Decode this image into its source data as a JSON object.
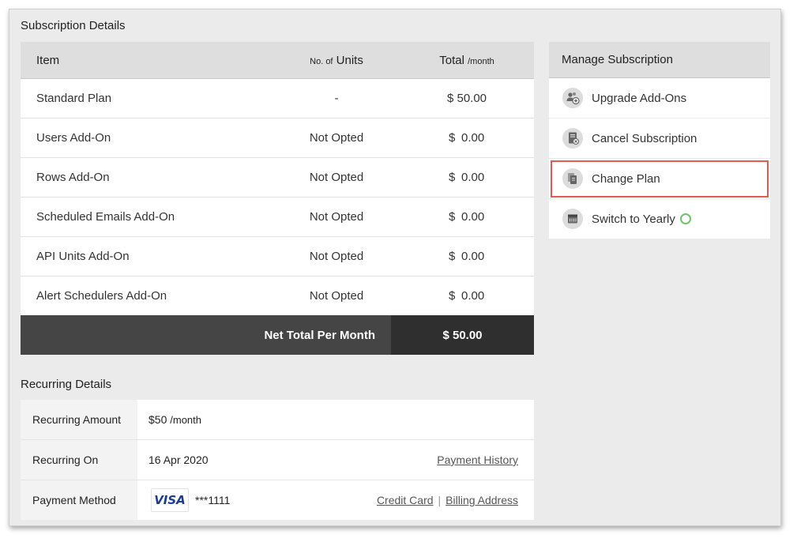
{
  "subscription": {
    "title": "Subscription Details",
    "headers": {
      "item": "Item",
      "units_prefix": "No. of",
      "units": "Units",
      "total": "Total",
      "total_suffix": "/month"
    },
    "rows": [
      {
        "item": "Standard Plan",
        "units": "-",
        "currency": "$",
        "amount": "50.00"
      },
      {
        "item": "Users Add-On",
        "units": "Not Opted",
        "currency": "$",
        "amount": "0.00"
      },
      {
        "item": "Rows Add-On",
        "units": "Not Opted",
        "currency": "$",
        "amount": "0.00"
      },
      {
        "item": "Scheduled Emails Add-On",
        "units": "Not Opted",
        "currency": "$",
        "amount": "0.00"
      },
      {
        "item": "API Units Add-On",
        "units": "Not Opted",
        "currency": "$",
        "amount": "0.00"
      },
      {
        "item": "Alert Schedulers Add-On",
        "units": "Not Opted",
        "currency": "$",
        "amount": "0.00"
      }
    ],
    "net_label": "Net Total Per Month",
    "net_value": "$ 50.00"
  },
  "manage": {
    "title": "Manage Subscription",
    "items": [
      {
        "label": "Upgrade Add-Ons",
        "icon": "users-plus-icon"
      },
      {
        "label": "Cancel Subscription",
        "icon": "cancel-receipt-icon"
      },
      {
        "label": "Change Plan",
        "icon": "documents-icon"
      },
      {
        "label": "Switch to Yearly",
        "icon": "calendar-icon"
      }
    ],
    "highlight_color": "#e35b50"
  },
  "recurring": {
    "title": "Recurring Details",
    "amount_label": "Recurring Amount",
    "amount_value": "$50",
    "amount_suffix": "/month",
    "on_label": "Recurring On",
    "on_value": "16 Apr 2020",
    "payment_history": "Payment History",
    "method_label": "Payment Method",
    "card_brand": "VISA",
    "card_number": "***1111",
    "credit_card_link": "Credit Card",
    "separator": "|",
    "billing_address_link": "Billing Address"
  }
}
